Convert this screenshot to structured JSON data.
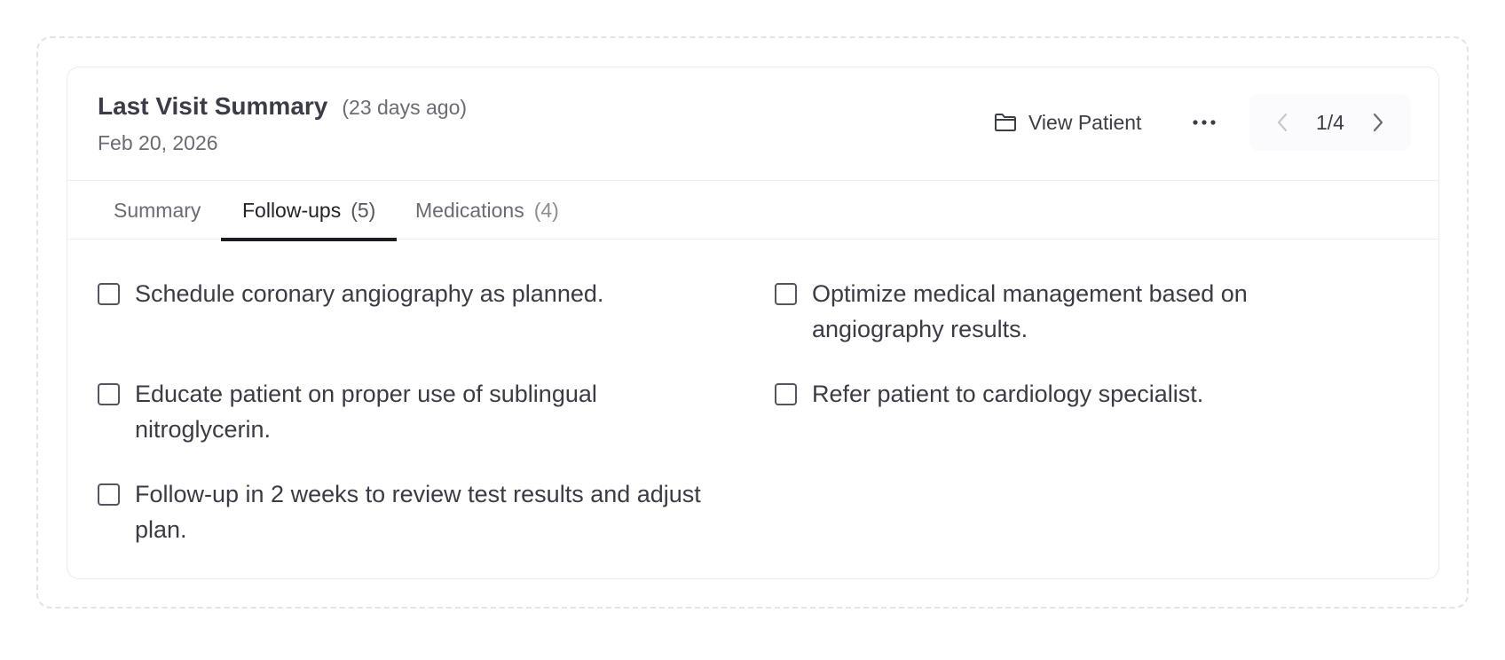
{
  "header": {
    "title": "Last Visit Summary",
    "ago": "(23 days ago)",
    "date": "Feb 20, 2026",
    "view_patient_label": "View Patient",
    "pager_label": "1/4"
  },
  "tabs": [
    {
      "label": "Summary",
      "count": ""
    },
    {
      "label": "Follow-ups",
      "count": "(5)",
      "active": true
    },
    {
      "label": "Medications",
      "count": "(4)"
    }
  ],
  "followups": [
    {
      "text": "Schedule coronary angiography as planned.",
      "checked": false
    },
    {
      "text": "Optimize medical management based on angiography results.",
      "checked": false
    },
    {
      "text": "Educate patient on proper use of sublingual nitroglycerin.",
      "checked": false
    },
    {
      "text": "Refer patient to cardiology specialist.",
      "checked": false
    },
    {
      "text": "Follow-up in 2 weeks to review test results and adjust plan.",
      "checked": false
    }
  ],
  "icons": {
    "view_patient": "folder-icon",
    "more": "more-horizontal-icon",
    "prev": "chevron-left-icon",
    "next": "chevron-right-icon"
  },
  "colors": {
    "active_tab_underline": "#1c1c22",
    "text_primary": "#3b3c48",
    "text_muted": "#6b6b75"
  }
}
